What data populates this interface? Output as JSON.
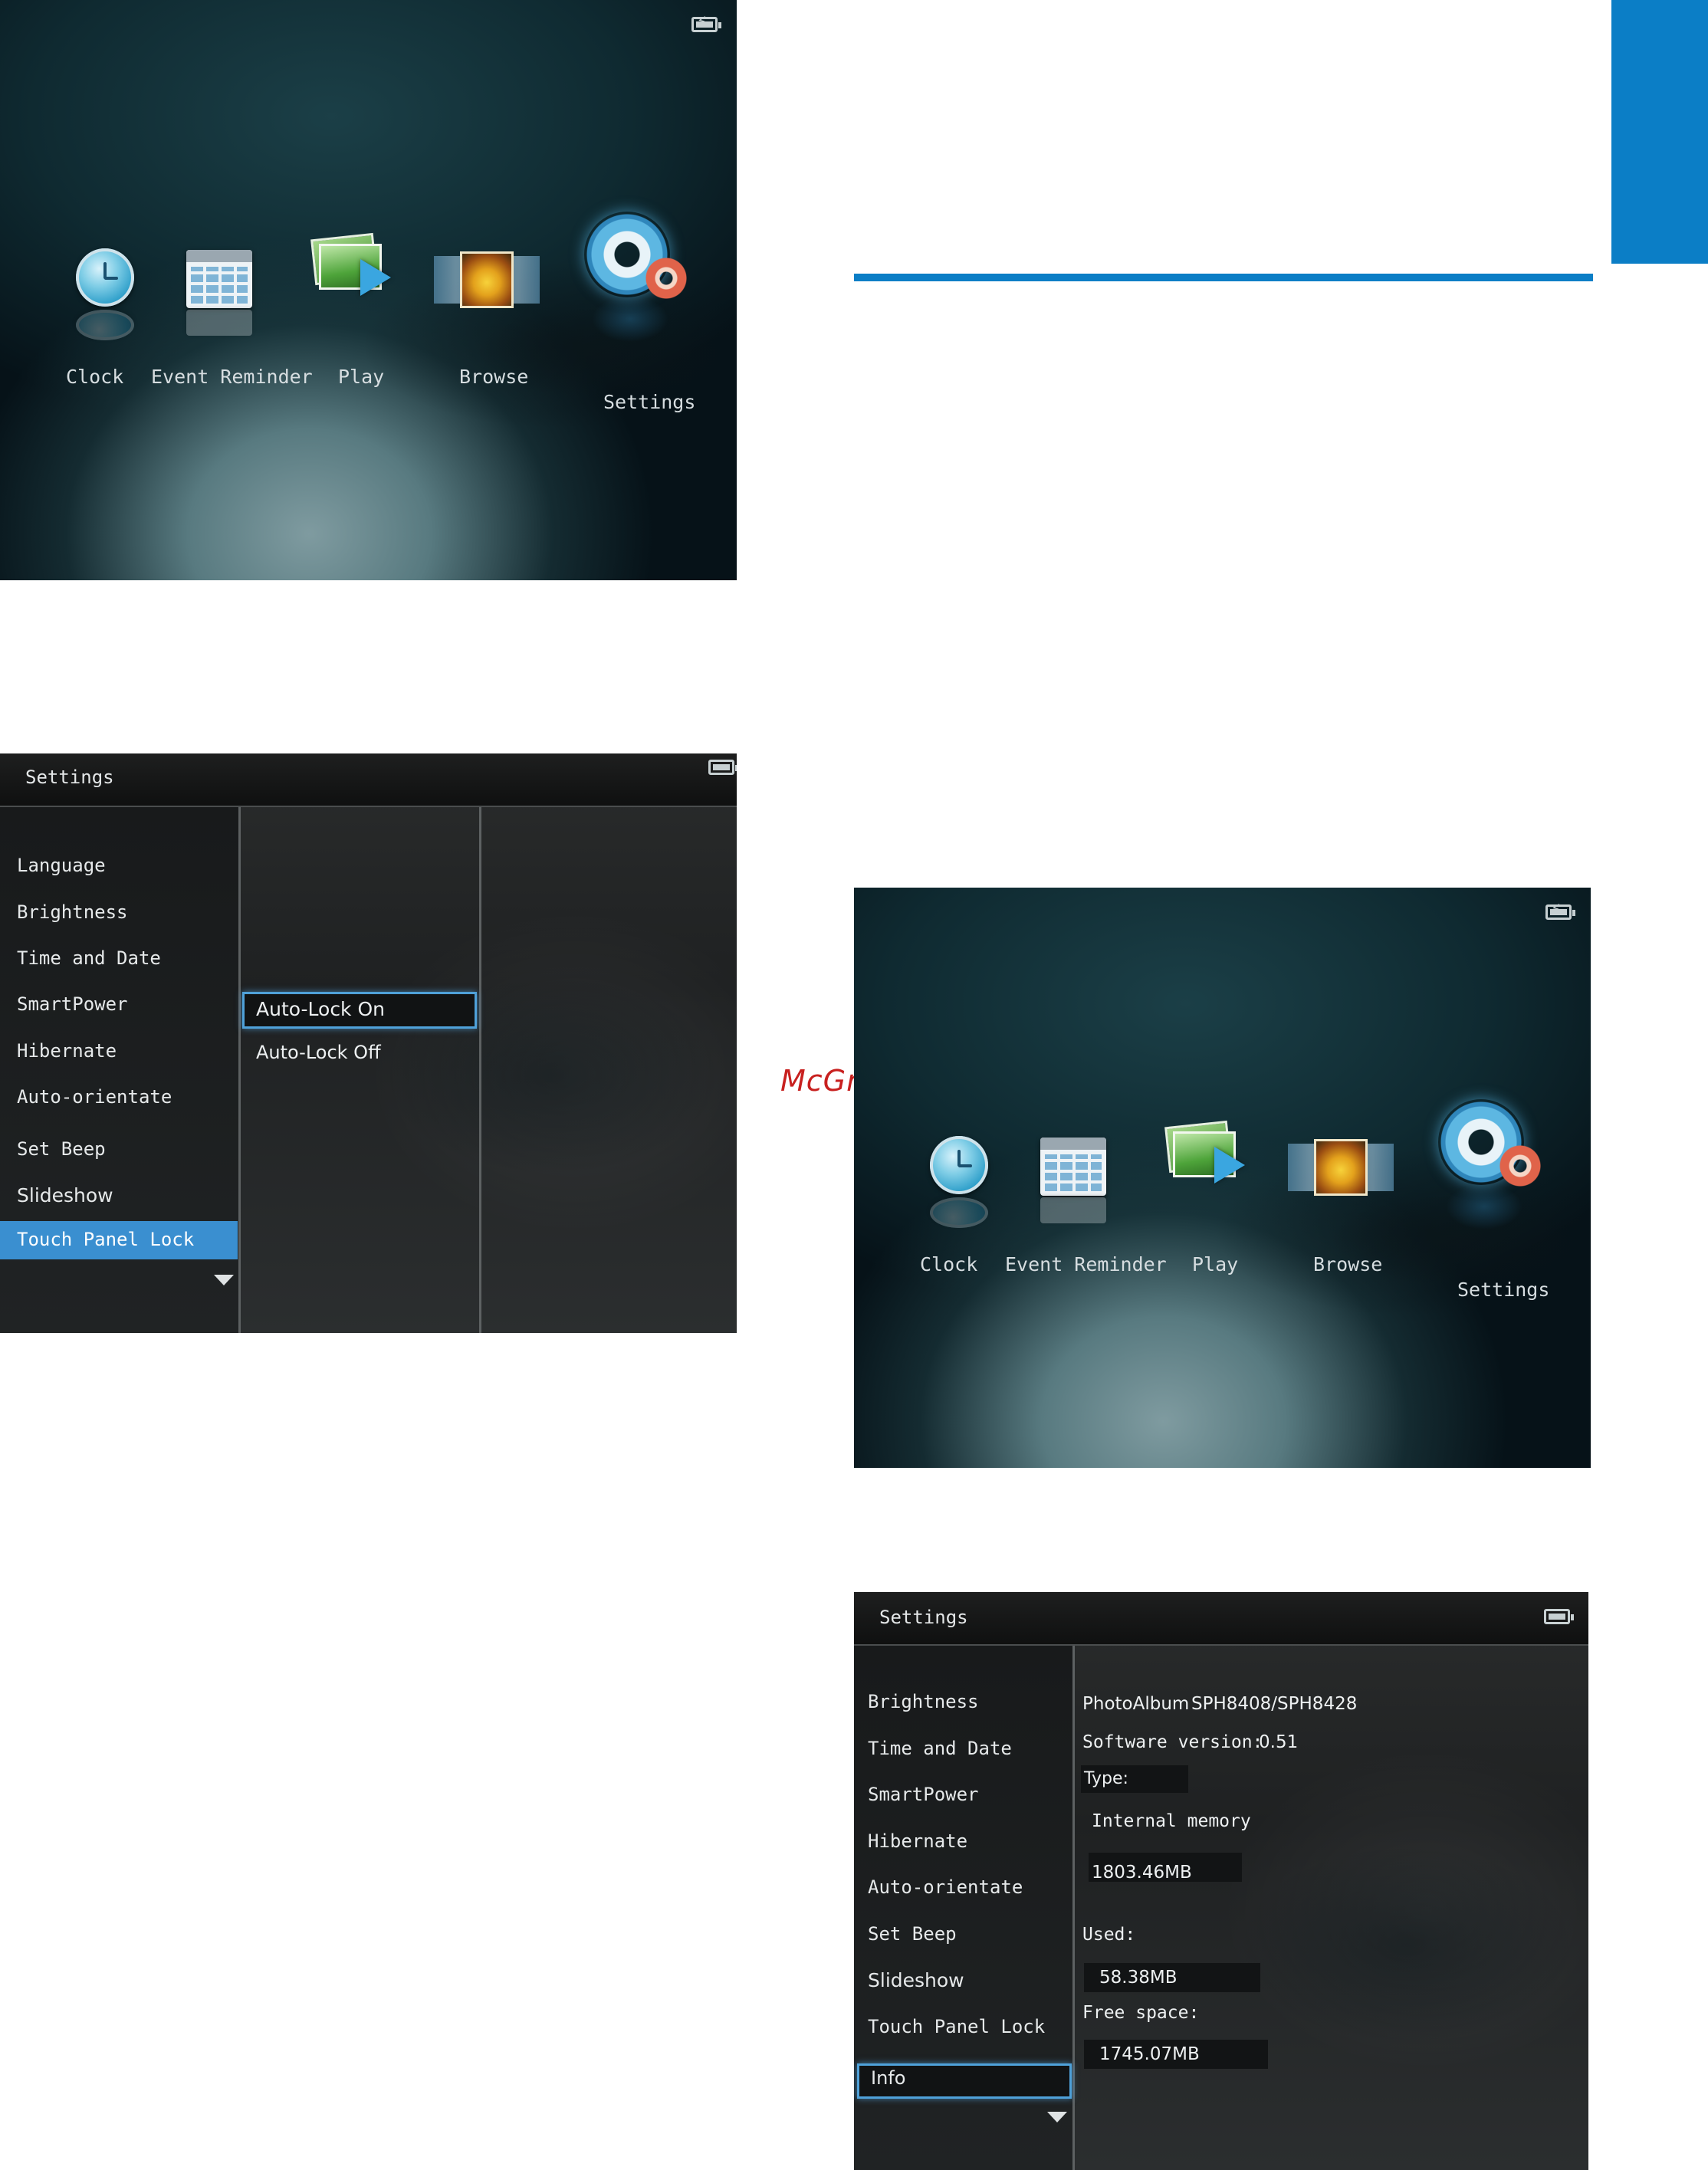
{
  "watermark": "McGrp.Ru",
  "colors": {
    "accent_blue": "#0b7ec6",
    "watermark_red": "#c8201f",
    "menu_highlight": "#3a8fd0"
  },
  "home_screen": {
    "items": [
      {
        "label": "Clock",
        "icon": "clock-icon"
      },
      {
        "label": "Event Reminder",
        "icon": "calendar-icon"
      },
      {
        "label": "Play",
        "icon": "play-icon"
      },
      {
        "label": "Browse",
        "icon": "browse-icon"
      },
      {
        "label": "Settings",
        "icon": "settings-icon"
      }
    ],
    "status_icon": "battery-charging-icon"
  },
  "settings_lock": {
    "title": "Settings",
    "menu": [
      "Language",
      "Brightness",
      "Time and Date",
      "SmartPower",
      "Hibernate",
      "Auto-orientate",
      "Set Beep",
      "Slideshow",
      "Touch Panel Lock"
    ],
    "selected": "Touch Panel Lock",
    "options": [
      "Auto-Lock On",
      "Auto-Lock Off"
    ],
    "selected_option": "Auto-Lock On"
  },
  "settings_info": {
    "title": "Settings",
    "menu": [
      "Brightness",
      "Time and Date",
      "SmartPower",
      "Hibernate",
      "Auto-orientate",
      "Set Beep",
      "Slideshow",
      "Touch Panel Lock",
      "Info"
    ],
    "selected": "Info",
    "info": {
      "model_label": "PhotoAlbum",
      "model_value": "SPH8408/SPH8428",
      "software_label": "Software version:",
      "software_value": "0.51",
      "type_label": "Type:",
      "memory_type": "Internal memory",
      "capacity": "1803.46MB",
      "used_label": "Used:",
      "used_value": "58.38MB",
      "free_label": "Free space:",
      "free_value": "1745.07MB"
    }
  }
}
